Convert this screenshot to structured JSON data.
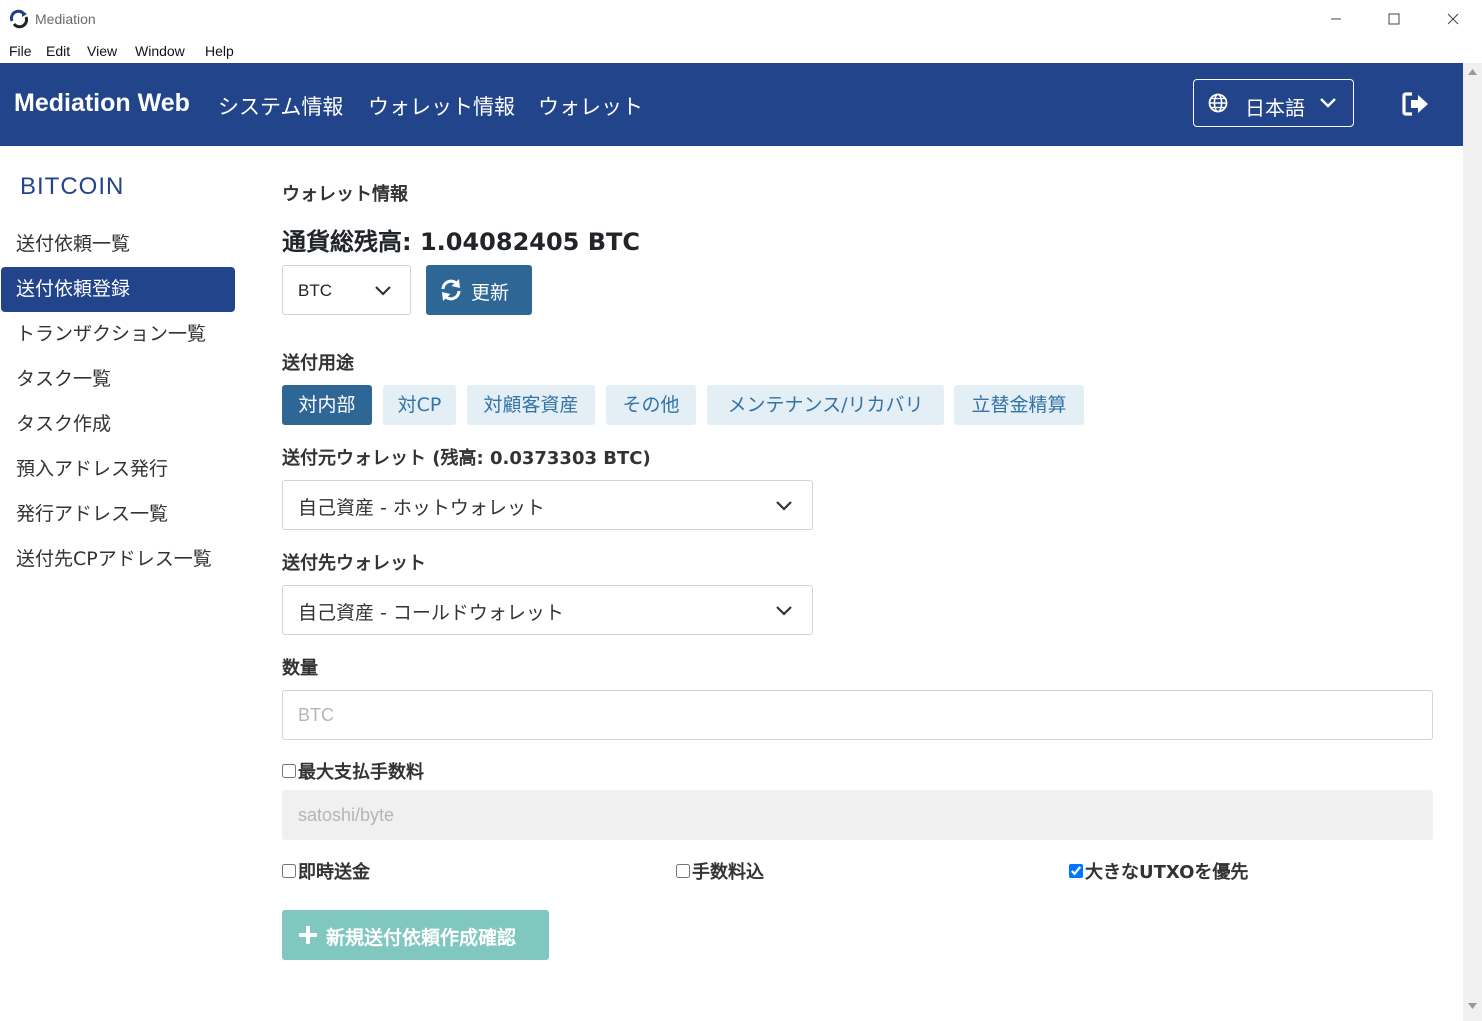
{
  "window": {
    "title": "Mediation",
    "menu": [
      "File",
      "Edit",
      "View",
      "Window",
      "Help"
    ]
  },
  "navbar": {
    "brand": "Mediation Web",
    "links": [
      "システム情報",
      "ウォレット情報",
      "ウォレット"
    ],
    "language": "日本語"
  },
  "sidebar": {
    "title": "BITCOIN",
    "items": [
      {
        "label": "送付依頼一覧",
        "active": false
      },
      {
        "label": "送付依頼登録",
        "active": true
      },
      {
        "label": "トランザクション一覧",
        "active": false
      },
      {
        "label": "タスク一覧",
        "active": false
      },
      {
        "label": "タスク作成",
        "active": false
      },
      {
        "label": "預入アドレス発行",
        "active": false
      },
      {
        "label": "発行アドレス一覧",
        "active": false
      },
      {
        "label": "送付先CPアドレス一覧",
        "active": false
      }
    ]
  },
  "main": {
    "section_title": "ウォレット情報",
    "total_balance": "通貨総残高: 1.04082405 BTC",
    "currency": "BTC",
    "refresh_label": "更新",
    "purpose_label": "送付用途",
    "purposes": [
      {
        "label": "対内部",
        "active": true
      },
      {
        "label": "対CP",
        "active": false
      },
      {
        "label": "対顧客資産",
        "active": false
      },
      {
        "label": "その他",
        "active": false
      },
      {
        "label": "メンテナンス/リカバリ",
        "active": false
      },
      {
        "label": "立替金精算",
        "active": false
      }
    ],
    "source_wallet_label": "送付元ウォレット (残高: 0.0373303 BTC)",
    "source_wallet_value": "自己資産 - ホットウォレット",
    "dest_wallet_label": "送付先ウォレット",
    "dest_wallet_value": "自己資産 - コールドウォレット",
    "amount_label": "数量",
    "amount_value": "",
    "amount_placeholder": "BTC",
    "max_fee_label": "最大支払手数料",
    "max_fee_checked": false,
    "max_fee_placeholder": "satoshi/byte",
    "options": [
      {
        "label": "即時送金",
        "checked": false
      },
      {
        "label": "手数料込",
        "checked": false
      },
      {
        "label": "大きなUTXOを優先",
        "checked": true
      }
    ],
    "submit_label": "新規送付依頼作成確認"
  },
  "colors": {
    "navbar": "#22448a",
    "primary": "#2e6796",
    "pill_bg": "#e4eef5",
    "submit_disabled": "#7fc7bf"
  }
}
